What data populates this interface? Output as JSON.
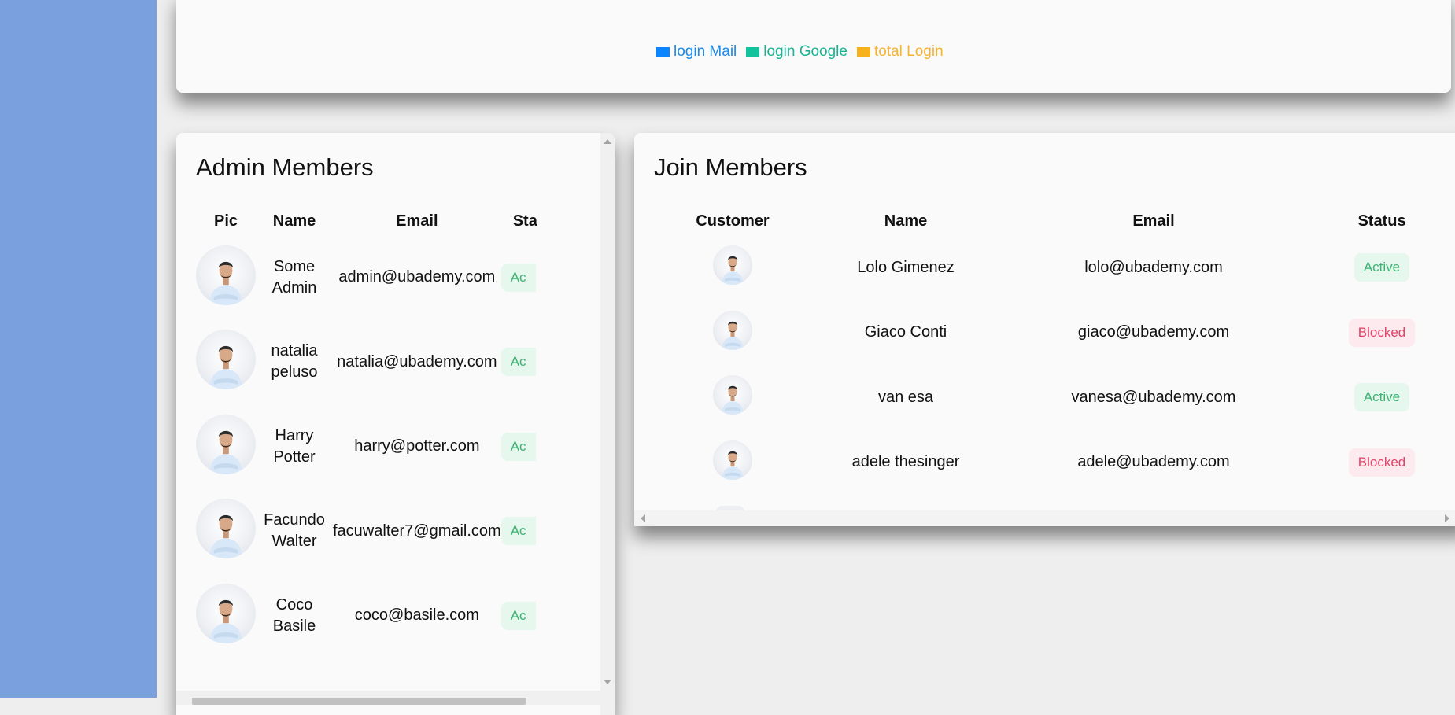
{
  "legend": [
    {
      "label": "login Mail",
      "color": "#1e88e5",
      "swatch": "#0a84ff"
    },
    {
      "label": "login Google",
      "color": "#19b394",
      "swatch": "#12c29a"
    },
    {
      "label": "total Login",
      "color": "#f5b335",
      "swatch": "#f7b11c"
    }
  ],
  "admin": {
    "title": "Admin Members",
    "headers": {
      "pic": "Pic",
      "name": "Name",
      "email": "Email",
      "status": "Sta"
    },
    "rows": [
      {
        "name_first": "Some",
        "name_last": "Admin",
        "email": "admin@ubademy.com",
        "status": "Ac"
      },
      {
        "name_first": "natalia",
        "name_last": "peluso",
        "email": "natalia@ubademy.com",
        "status": "Ac"
      },
      {
        "name_first": "Harry",
        "name_last": "Potter",
        "email": "harry@potter.com",
        "status": "Ac"
      },
      {
        "name_first": "Facundo",
        "name_last": "Walter",
        "email": "facuwalter7@gmail.com",
        "status": "Ac"
      },
      {
        "name_first": "Coco",
        "name_last": "Basile",
        "email": "coco@basile.com",
        "status": "Ac"
      }
    ]
  },
  "join": {
    "title": "Join Members",
    "headers": {
      "customer": "Customer",
      "name": "Name",
      "email": "Email",
      "status": "Status"
    },
    "rows": [
      {
        "name": "Lolo Gimenez",
        "email": "lolo@ubademy.com",
        "status": "Active"
      },
      {
        "name": "Giaco Conti",
        "email": "giaco@ubademy.com",
        "status": "Blocked"
      },
      {
        "name": "van esa",
        "email": "vanesa@ubademy.com",
        "status": "Active"
      },
      {
        "name": "adele thesinger",
        "email": "adele@ubademy.com",
        "status": "Blocked"
      }
    ]
  },
  "colors": {
    "sidebar": "#7aa0de",
    "active_bg": "#e6f7ee",
    "active_text": "#3cb371",
    "blocked_bg": "#fdeaee",
    "blocked_text": "#e0446a"
  }
}
